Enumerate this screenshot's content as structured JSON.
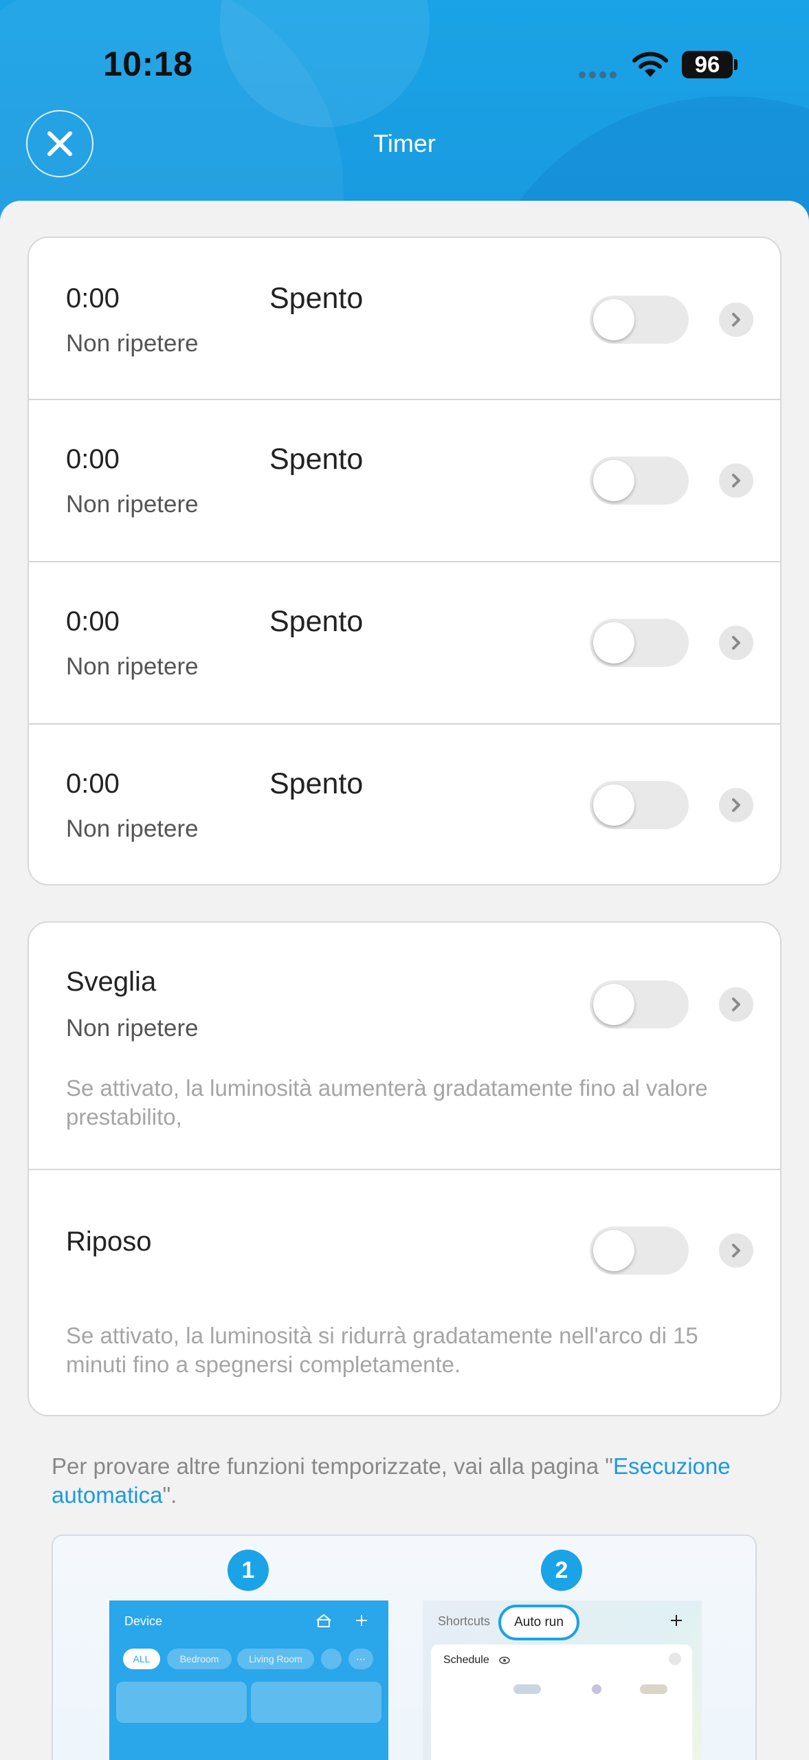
{
  "status_bar": {
    "time": "10:18",
    "battery": "96"
  },
  "nav": {
    "title": "Timer"
  },
  "timers": [
    {
      "time": "0:00",
      "state": "Spento",
      "repeat": "Non ripetere",
      "enabled": false
    },
    {
      "time": "0:00",
      "state": "Spento",
      "repeat": "Non ripetere",
      "enabled": false
    },
    {
      "time": "0:00",
      "state": "Spento",
      "repeat": "Non ripetere",
      "enabled": false
    },
    {
      "time": "0:00",
      "state": "Spento",
      "repeat": "Non ripetere",
      "enabled": false
    }
  ],
  "wake": {
    "title": "Sveglia",
    "repeat": "Non ripetere",
    "description": "Se attivato, la luminosità aumenterà gradatamente fino al valore prestabilito,",
    "enabled": false
  },
  "sleep": {
    "title": "Riposo",
    "description": "Se attivato, la luminosità si ridurrà gradatamente nell'arco di 15 minuti fino a spegnersi completamente.",
    "enabled": false
  },
  "footer": {
    "text_before": "Per provare altre funzioni temporizzate, vai alla pagina \"",
    "link": "Esecuzione automatica",
    "text_after": "\"."
  },
  "promo": {
    "step1": "1",
    "step2": "2",
    "shot1": {
      "title": "Device",
      "tabs": [
        "ALL",
        "Bedroom",
        "Living Room"
      ]
    },
    "shot2": {
      "tab_shortcuts": "Shortcuts",
      "tab_auto": "Auto run",
      "section": "Schedule"
    }
  },
  "colors": {
    "accent": "#1aa3e6",
    "link": "#1a9ae0"
  }
}
